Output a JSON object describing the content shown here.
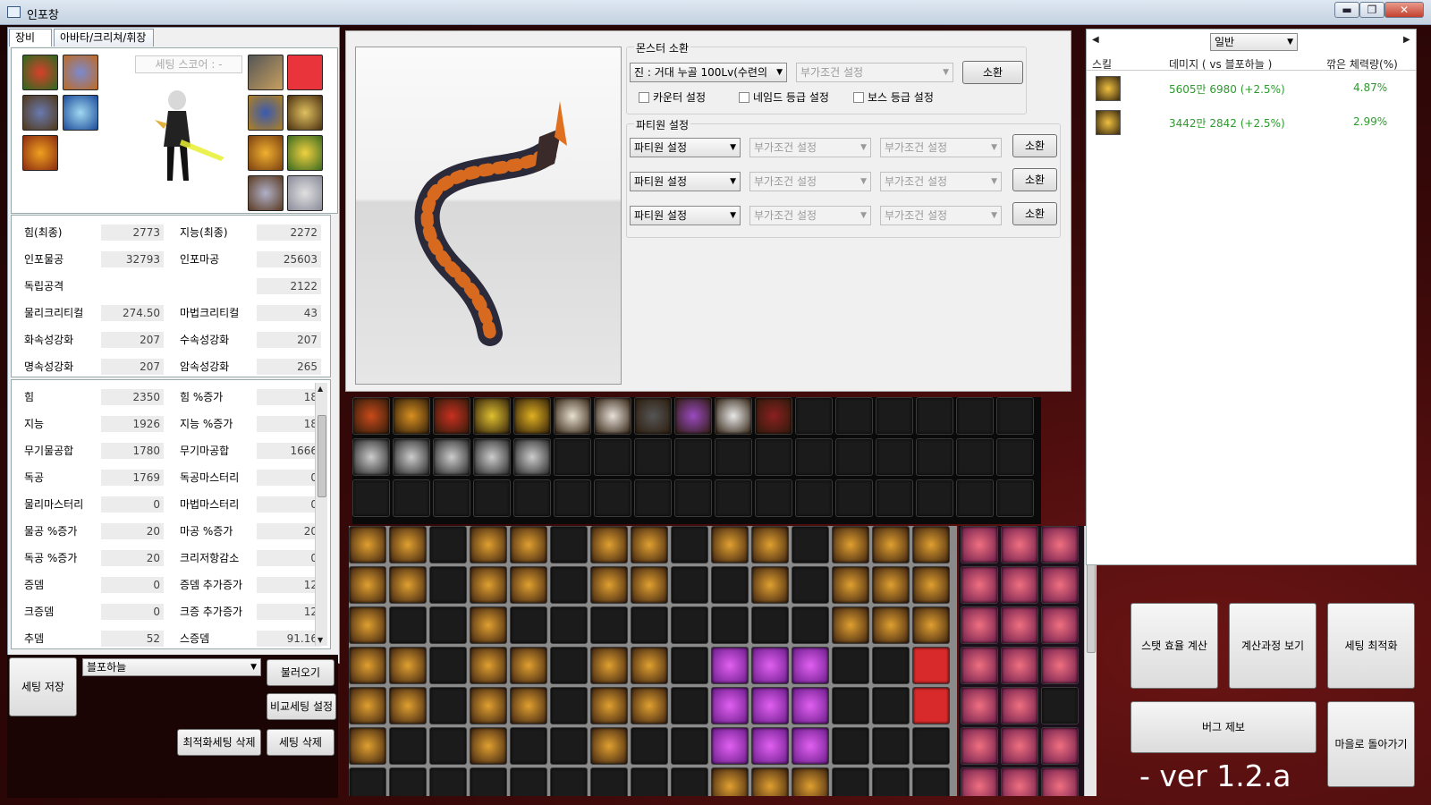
{
  "window": {
    "title": "인포창",
    "minimize": "▬",
    "maximize": "❐",
    "close": "✕"
  },
  "tabs": [
    "장비",
    "아바타/크리쳐/휘장"
  ],
  "setting_score_placeholder": "세팅 스코어 : -",
  "final_stats": [
    {
      "l1": "힘(최종)",
      "v1": "2773",
      "l2": "지능(최종)",
      "v2": "2272"
    },
    {
      "l1": "인포물공",
      "v1": "32793",
      "l2": "인포마공",
      "v2": "25603"
    },
    {
      "l1": "독립공격",
      "v1": "",
      "l2": "",
      "v2": "2122"
    },
    {
      "l1": "물리크리티컬",
      "v1": "274.50",
      "l2": "마법크리티컬",
      "v2": "43"
    },
    {
      "l1": "화속성강화",
      "v1": "207",
      "l2": "수속성강화",
      "v2": "207"
    },
    {
      "l1": "명속성강화",
      "v1": "207",
      "l2": "암속성강화",
      "v2": "265"
    }
  ],
  "detail_stats": [
    {
      "l1": "힘",
      "v1": "2350",
      "l2": "힘 %증가",
      "v2": "18"
    },
    {
      "l1": "지능",
      "v1": "1926",
      "l2": "지능 %증가",
      "v2": "18"
    },
    {
      "l1": "무기물공합",
      "v1": "1780",
      "l2": "무기마공합",
      "v2": "1666"
    },
    {
      "l1": "독공",
      "v1": "1769",
      "l2": "독공마스터리",
      "v2": "0"
    },
    {
      "l1": "물리마스터리",
      "v1": "0",
      "l2": "마법마스터리",
      "v2": "0"
    },
    {
      "l1": "물공 %증가",
      "v1": "20",
      "l2": "마공 %증가",
      "v2": "20"
    },
    {
      "l1": "독공 %증가",
      "v1": "20",
      "l2": "크리저항감소",
      "v2": "0"
    },
    {
      "l1": "증뎀",
      "v1": "0",
      "l2": "증뎀 추가증가",
      "v2": "12"
    },
    {
      "l1": "크증뎀",
      "v1": "0",
      "l2": "크증 추가증가",
      "v2": "12"
    },
    {
      "l1": "추뎀",
      "v1": "52",
      "l2": "스증뎀",
      "v2": "91.16"
    }
  ],
  "bottom_left": {
    "save_setting": "세팅 저장",
    "preset": "블포하늘",
    "load": "불러오기",
    "compare": "비교세팅 설정",
    "delete_optimized": "최적화세팅 삭제",
    "delete_setting": "세팅 삭제"
  },
  "monster": {
    "group": "몬스터 소환",
    "selected": "진 : 거대 누골 100Lv(수련의",
    "extra": "부가조건 설정",
    "summon": "소환",
    "counter": "카운터 설정",
    "named": "네임드 등급 설정",
    "boss": "보스 등급 설정"
  },
  "party": {
    "group": "파티원 설정",
    "rows": [
      {
        "member": "파티원 설정",
        "c1": "부가조건 설정",
        "c2": "부가조건 설정",
        "btn": "소환"
      },
      {
        "member": "파티원 설정",
        "c1": "부가조건 설정",
        "c2": "부가조건 설정",
        "btn": "소환"
      },
      {
        "member": "파티원 설정",
        "c1": "부가조건 설정",
        "c2": "부가조건 설정",
        "btn": "소환"
      }
    ]
  },
  "right": {
    "mode": "일반",
    "headers": [
      "스킬",
      "데미지 ( vs 블포하늘 )",
      "깎은 체력량(%)"
    ],
    "rows": [
      {
        "damage": "5605만 6980 (+2.5%)",
        "pct": "4.87%"
      },
      {
        "damage": "3442만 2842 (+2.5%)",
        "pct": "2.99%"
      }
    ],
    "stat_eff": "스탯 효율 계산",
    "calc_view": "계산과정 보기",
    "optimize": "세팅 최적화",
    "bug_report": "버그 제보",
    "back_town": "마을로 돌아가기",
    "version": "- ver 1.2.a"
  },
  "colors": {
    "damage_green": "#2e9a2e",
    "dark_bg": "#3a0909"
  }
}
